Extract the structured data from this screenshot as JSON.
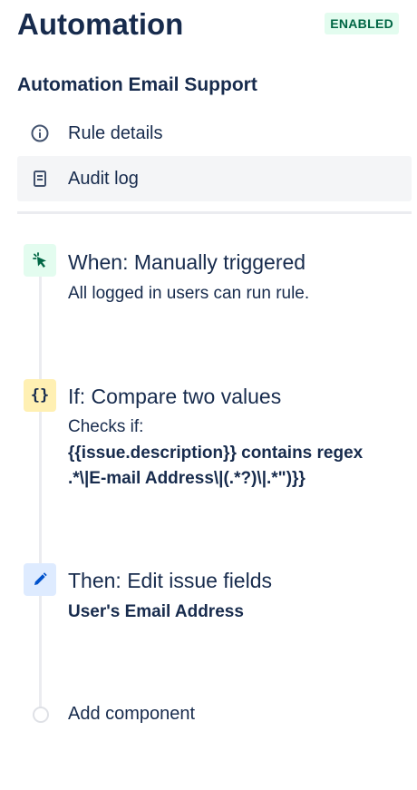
{
  "header": {
    "title": "Automation",
    "status_badge": "ENABLED"
  },
  "rule": {
    "name": "Automation Email Support"
  },
  "nav": {
    "rule_details": "Rule details",
    "audit_log": "Audit log",
    "selected": "audit_log"
  },
  "components": {
    "trigger": {
      "title": "When: Manually triggered",
      "description": "All logged in users can run rule.",
      "icon": "cursor-click-icon",
      "color": "#e3fcef"
    },
    "condition": {
      "title": "If: Compare two values",
      "description": "Checks if:",
      "line1": "{{issue.description}} contains regex",
      "line2": ".*\\|E-mail Address\\|(.*?)\\|.*\")}}",
      "icon": "braces-icon",
      "color": "#fff0b3"
    },
    "action": {
      "title": "Then: Edit issue fields",
      "field": "User's Email Address",
      "icon": "pencil-icon",
      "color": "#deebff"
    }
  },
  "add_component": {
    "label": "Add component"
  }
}
